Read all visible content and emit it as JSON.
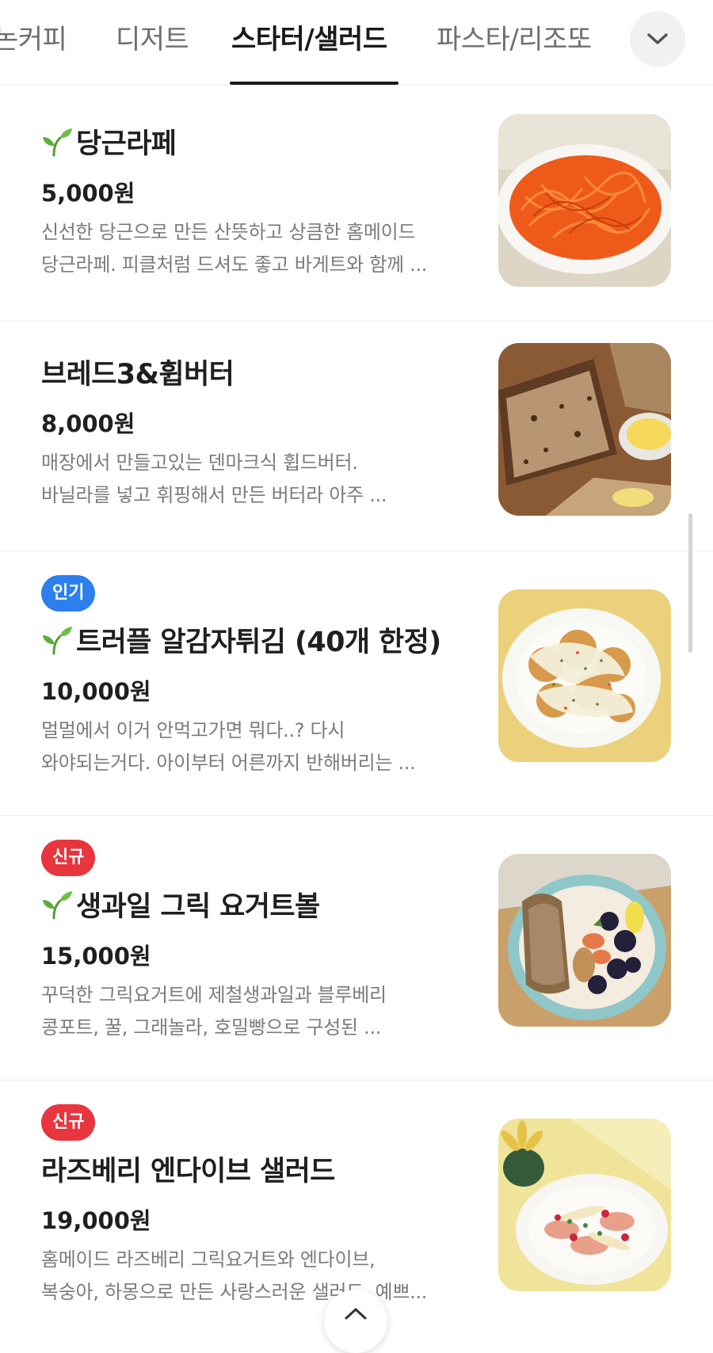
{
  "tabs": [
    {
      "label": "논커피",
      "active": false
    },
    {
      "label": "디저트",
      "active": false
    },
    {
      "label": "스타터/샐러드",
      "active": true
    },
    {
      "label": "파스타/리조또",
      "active": false
    }
  ],
  "dropdown_icon": "chevron-down-icon",
  "items": [
    {
      "badge": "",
      "sprout": true,
      "name": "당근라페",
      "price": "5,000원",
      "desc_line1": "신선한 당근으로 만든 산뜻하고 상큼한 홈메이드",
      "desc_line2": "당근라페. 피클처럼 드셔도 좋고 바게트와 함께 ..."
    },
    {
      "badge": "",
      "sprout": false,
      "name": "브레드3&휩버터",
      "price": "8,000원",
      "desc_line1": "매장에서 만들고있는 덴마크식 휩드버터.",
      "desc_line2": "바닐라를 넣고 휘핑해서 만든 버터라 아주 ..."
    },
    {
      "badge": "인기",
      "badge_type": "popular",
      "sprout": true,
      "name": "트러플 알감자튀김 (40개 한정)",
      "price": "10,000원",
      "desc_line1": "멀멀에서 이거 안먹고가면 뭐다..? 다시",
      "desc_line2": "와야되는거다. 아이부터 어른까지 반해버리는 ..."
    },
    {
      "badge": "신규",
      "badge_type": "new",
      "sprout": true,
      "name": "생과일 그릭 요거트볼",
      "price": "15,000원",
      "desc_line1": "꾸덕한 그릭요거트에 제철생과일과 블루베리",
      "desc_line2": "콩포트, 꿀, 그래놀라, 호밀빵으로 구성된 ..."
    },
    {
      "badge": "신규",
      "badge_type": "new",
      "sprout": false,
      "name": "라즈베리 엔다이브 샐러드",
      "price": "19,000원",
      "desc_line1": "홈메이드 라즈베리 그릭요거트와 엔다이브,",
      "desc_line2": "복숭아, 하몽으로 만든 사랑스러운 샐러드. 예쁘..."
    }
  ],
  "scroll_top_icon": "chevron-up-icon",
  "colors": {
    "popular_badge": "#2d7ff0",
    "new_badge": "#e8353e",
    "sprout": "#5cae3a"
  }
}
